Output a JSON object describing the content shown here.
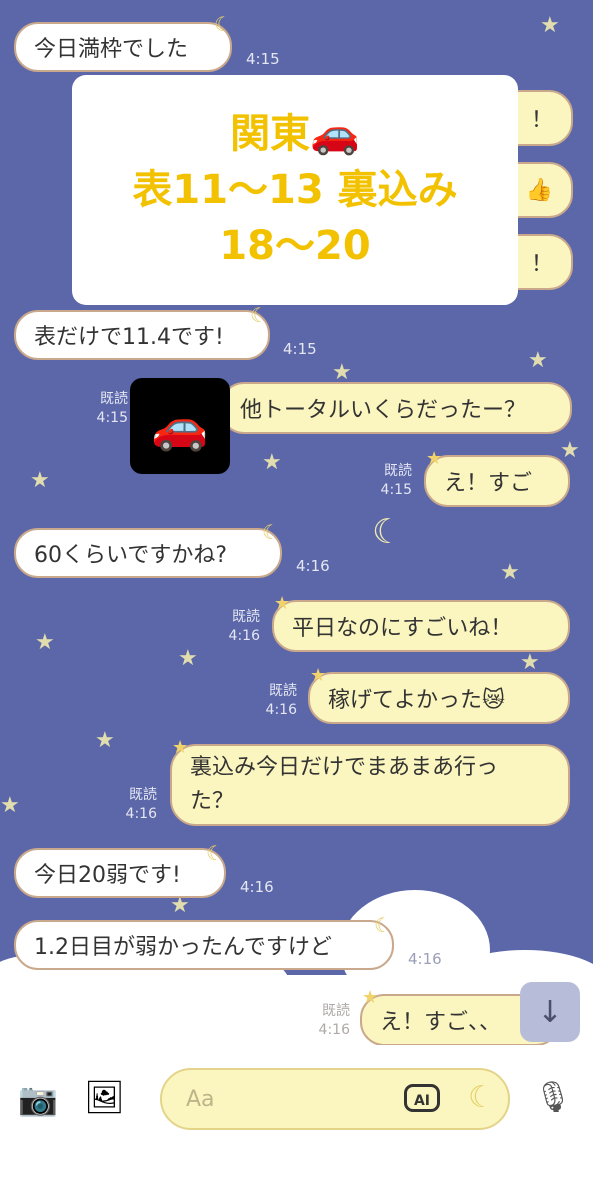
{
  "overlay": {
    "line1": "関東🚗",
    "line2": "表11〜13 裏込み",
    "line3": "18〜20"
  },
  "messages": [
    {
      "text": "今日満枠でした",
      "time": "4:15"
    },
    {
      "text": "表だけで11.4です!",
      "time": "4:15"
    },
    {
      "text": "他トータルいくらだったー？",
      "read": "既読",
      "time": "4:15"
    },
    {
      "text": "え！すご",
      "read": "既読",
      "time": "4:15"
    },
    {
      "text": "60くらいですかね?",
      "time": "4:16"
    },
    {
      "text": "平日なのにすごいね！",
      "read": "既読",
      "time": "4:16"
    },
    {
      "text": "稼げてよかった😿",
      "read": "既読",
      "time": "4:16"
    },
    {
      "text_line1": "裏込み今日だけでまあまあ行っ",
      "text_line2": "た？",
      "read": "既読",
      "time": "4:16"
    },
    {
      "text": "今日20弱です!",
      "time": "4:16"
    },
    {
      "text": "1.2日目が弱かったんですけど",
      "time": "4:16"
    },
    {
      "text": "え！すご、、",
      "read": "既読",
      "time": "4:16"
    }
  ],
  "hidden_bubble_marks": [
    "！",
    "👍",
    "！"
  ],
  "car_image": "🚗",
  "composer": {
    "placeholder": "Aa",
    "ai_label": "AI"
  },
  "icons": [
    "camera-icon",
    "image-icon",
    "scroll-down-icon",
    "ai-icon",
    "moon-icon",
    "microphone-icon"
  ],
  "colors": {
    "background": "#5b67a8",
    "sent_bubble": "#fbf6bf",
    "received_bubble": "#ffffff",
    "overlay_text": "#f2c200"
  }
}
